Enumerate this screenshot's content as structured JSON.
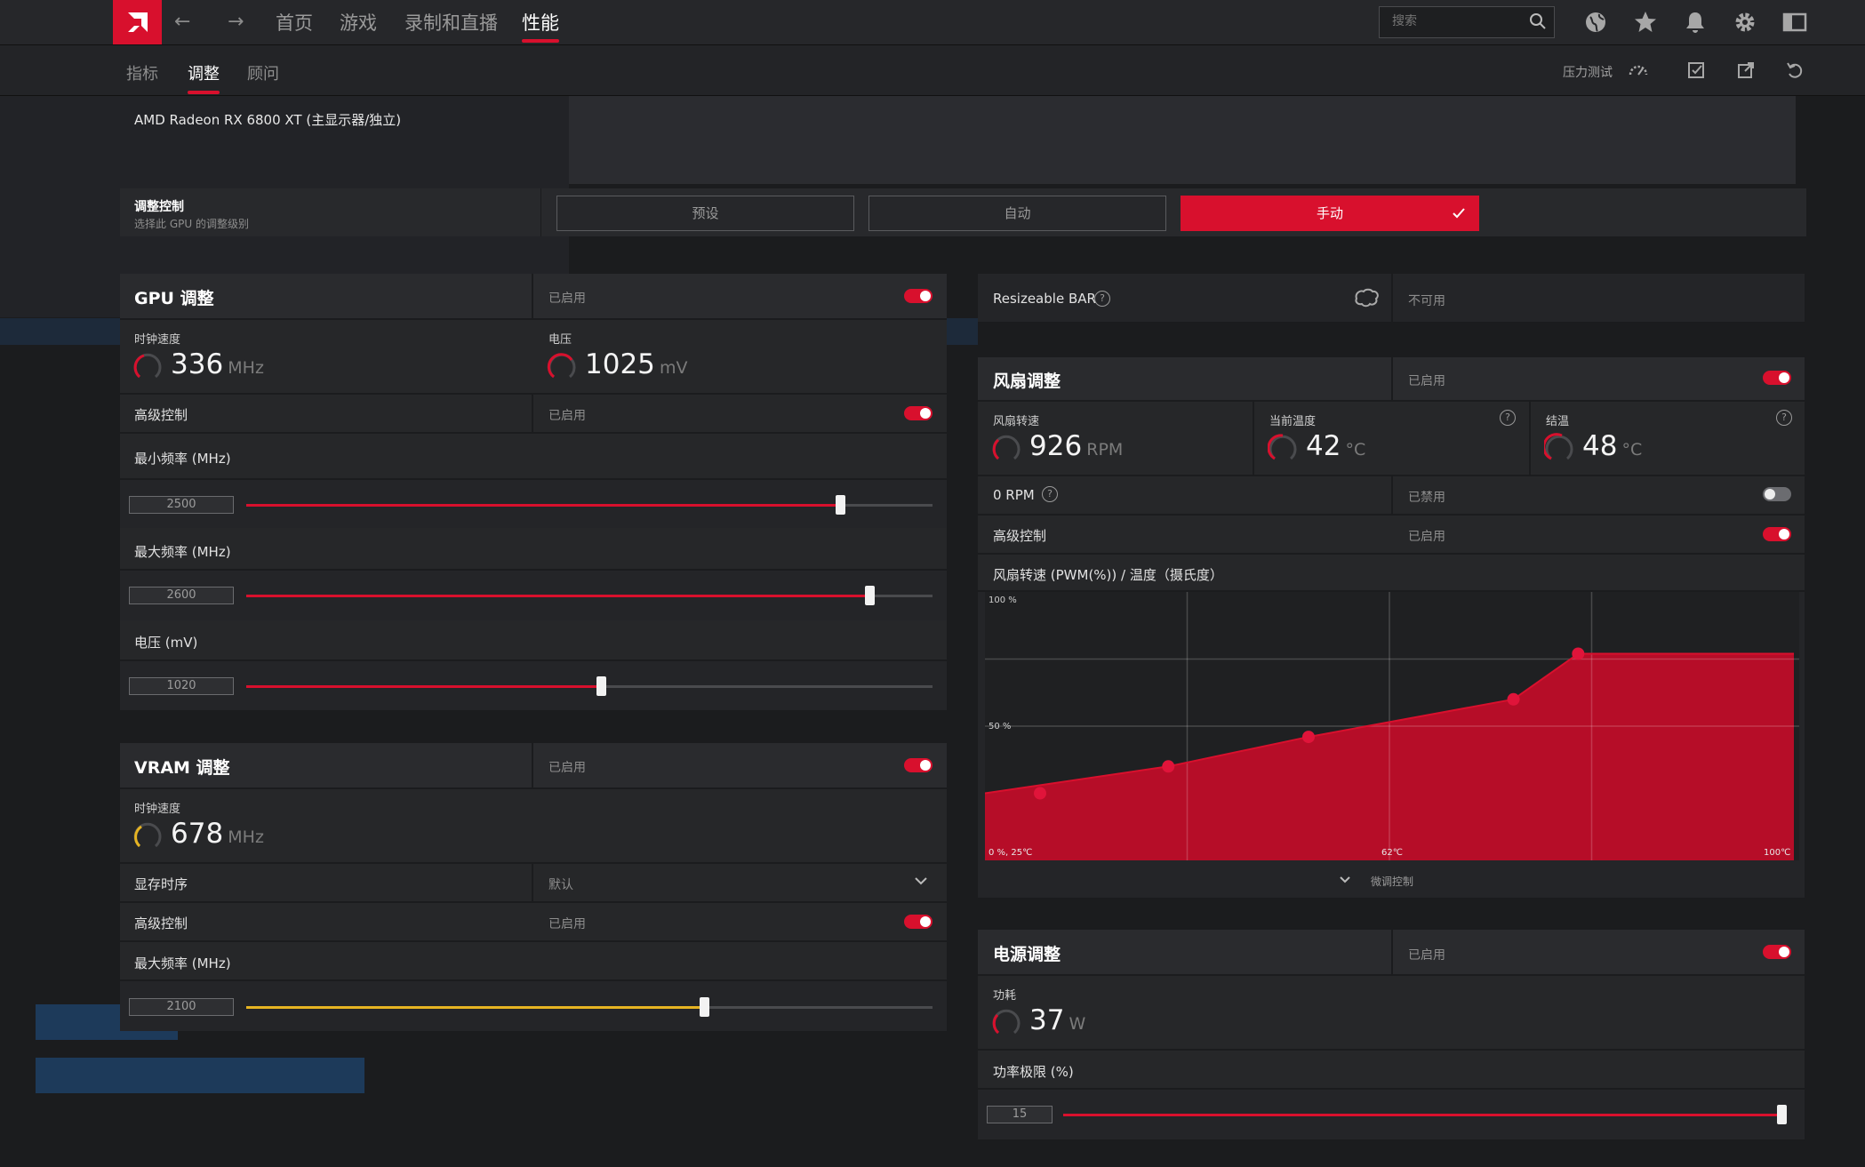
{
  "topbar": {
    "back_label": "←",
    "forward_label": "→",
    "tabs": [
      "首页",
      "游戏",
      "录制和直播",
      "性能"
    ],
    "search_placeholder": "搜索"
  },
  "subbar": {
    "tabs": [
      "指标",
      "调整",
      "顾问"
    ],
    "stress_test_label": "压力测试"
  },
  "device": {
    "name": "AMD Radeon RX 6800 XT (主显示器/独立)"
  },
  "tuning_control": {
    "title": "调整控制",
    "subtitle": "选择此 GPU 的调整级别",
    "modes": [
      "预设",
      "自动",
      "手动"
    ],
    "active_mode": "手动"
  },
  "gpu": {
    "title": "GPU 调整",
    "status": "已启用",
    "clock_label": "时钟速度",
    "clock_value": "336",
    "clock_unit": "MHz",
    "voltage_label": "电压",
    "voltage_value": "1025",
    "voltage_unit": "mV",
    "adv_label": "高级控制",
    "adv_status": "已启用",
    "min_freq_label": "最小频率 (MHz)",
    "min_freq_value": "2500",
    "min_freq_fraction": 0.865,
    "max_freq_label": "最大频率 (MHz)",
    "max_freq_value": "2600",
    "max_freq_fraction": 0.908,
    "volt_label": "电压 (mV)",
    "volt_value": "1020",
    "volt_fraction": 0.517
  },
  "vram": {
    "title": "VRAM 调整",
    "status": "已启用",
    "clock_label": "时钟速度",
    "clock_value": "678",
    "clock_unit": "MHz",
    "timing_label": "显存时序",
    "timing_value": "默认",
    "adv_label": "高级控制",
    "adv_status": "已启用",
    "max_freq_label": "最大频率 (MHz)",
    "max_freq_value": "2100",
    "max_freq_fraction": 0.667
  },
  "rebar": {
    "label": "Resizeable BAR",
    "status": "不可用"
  },
  "fan": {
    "title": "风扇调整",
    "status": "已启用",
    "speed_label": "风扇转速",
    "speed_value": "926",
    "speed_unit": "RPM",
    "temp_label": "当前温度",
    "temp_value": "42",
    "temp_unit": "°C",
    "junction_label": "结温",
    "junction_value": "48",
    "junction_unit": "°C",
    "zero_rpm_label": "0 RPM",
    "zero_rpm_status": "已禁用",
    "adv_label": "高级控制",
    "adv_status": "已启用",
    "curve_label": "风扇转速 (PWM(%)) / 温度（摄氏度）",
    "fine_label": "微调控制"
  },
  "power": {
    "title": "电源调整",
    "status": "已启用",
    "draw_label": "功耗",
    "draw_value": "37",
    "draw_unit": "W",
    "limit_label": "功率极限 (%)",
    "limit_value": "15",
    "limit_fraction": 1.0
  },
  "colors": {
    "accent": "#d8102d",
    "vram_accent": "#e6b422",
    "background": "#1b1c1e"
  },
  "chart_data": {
    "type": "area",
    "x": [
      25,
      42,
      55,
      74,
      80,
      100
    ],
    "y": [
      25,
      35,
      46,
      60,
      77,
      77
    ],
    "xlim": [
      25,
      100
    ],
    "ylim": [
      0,
      100
    ],
    "tick_labels": {
      "y_top": "100 %",
      "y_mid": "50 %",
      "origin": "0 %, 25℃",
      "x_mid": "62℃",
      "x_max": "100℃"
    }
  }
}
